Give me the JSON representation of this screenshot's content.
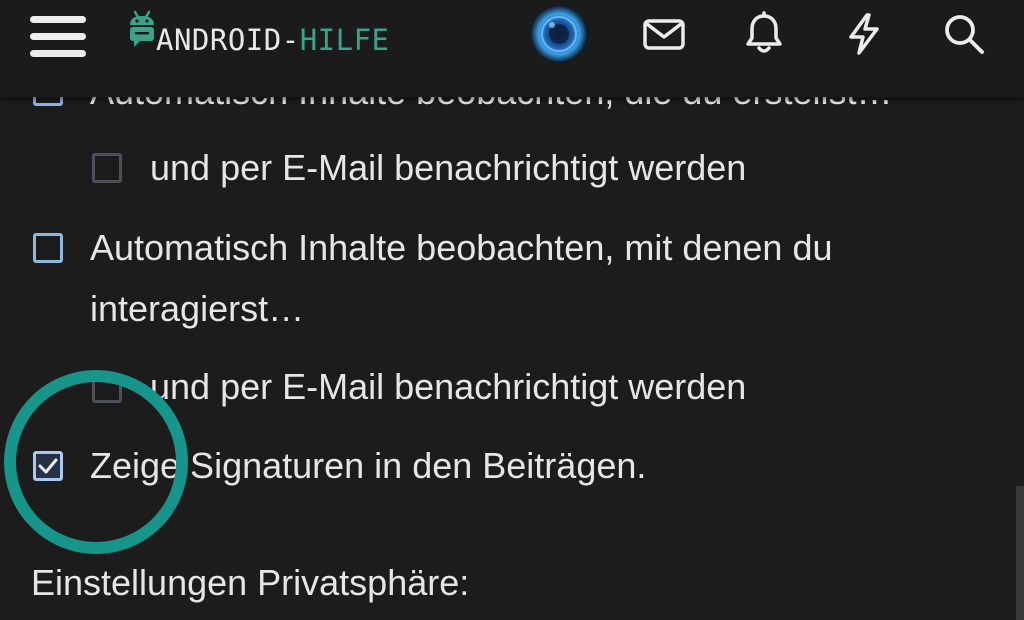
{
  "header": {
    "logo": {
      "part1": "ANDROID-",
      "part2": "HILFE"
    },
    "icons": [
      "menu-icon",
      "avatar",
      "mail-icon",
      "bell-icon",
      "lightning-icon",
      "search-icon"
    ]
  },
  "settings": {
    "cut_off_top": "Automatisch Inhalte beobachten, die du erstellst…",
    "items": [
      {
        "label": "und per E-Mail benachrichtigt werden",
        "checked": false,
        "level": "sub"
      },
      {
        "label_line1": "Automatisch Inhalte beobachten, mit denen du",
        "label_line2": "interagierst…",
        "checked": false,
        "level": "top"
      },
      {
        "label": "und per E-Mail benachrichtigt werden",
        "checked": false,
        "level": "sub"
      },
      {
        "label": "Zeige Signaturen in den Beiträgen.",
        "checked": true,
        "level": "top"
      }
    ],
    "section_heading": "Einstellungen Privatsphäre:"
  },
  "colors": {
    "background": "#1c1c1c",
    "text": "#e6e6e6",
    "accent_green": "#3aa389",
    "checkbox_blue": "#8fb7e3",
    "highlight_ring": "#18958a"
  }
}
